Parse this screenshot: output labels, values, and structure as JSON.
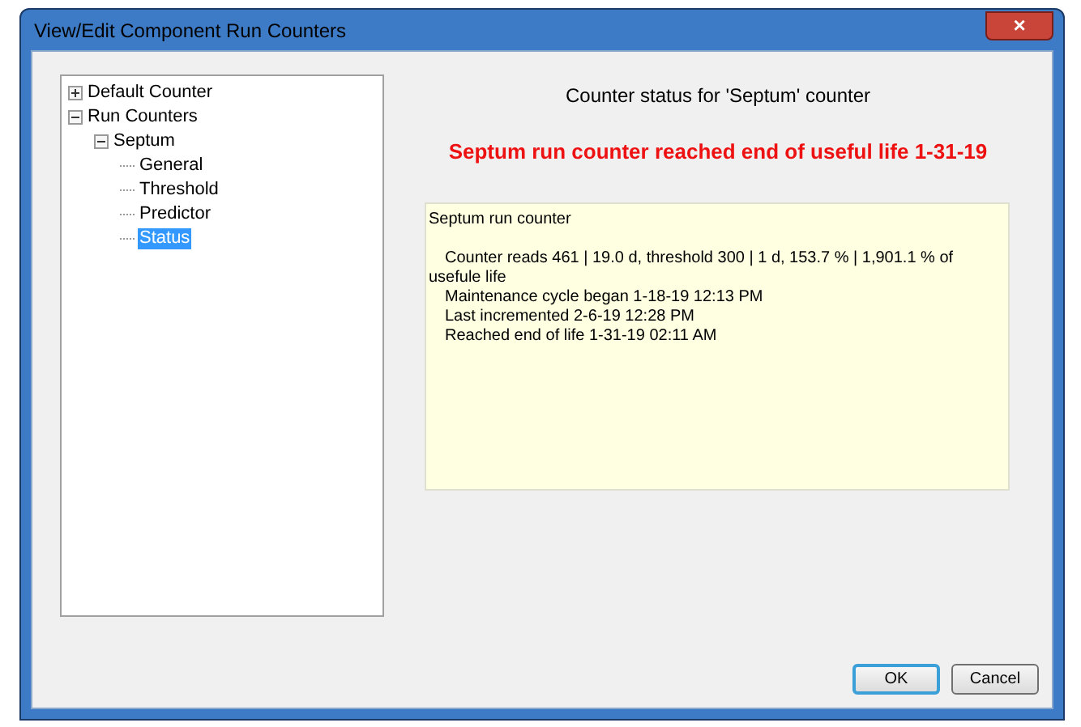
{
  "window": {
    "title": "View/Edit Component Run Counters",
    "close": "×"
  },
  "tree": [
    {
      "label": "Default Counter",
      "expanded": false,
      "selected": false
    },
    {
      "label": "Run Counters",
      "expanded": true,
      "selected": false,
      "children": [
        {
          "label": "Septum",
          "expanded": true,
          "selected": false,
          "children": [
            {
              "label": "General",
              "selected": false
            },
            {
              "label": "Threshold",
              "selected": false
            },
            {
              "label": "Predictor",
              "selected": false
            },
            {
              "label": "Status",
              "selected": true
            }
          ]
        }
      ]
    }
  ],
  "heading": "Counter status for 'Septum' counter",
  "alert": "Septum run counter reached end of useful life 1-31-19",
  "details": {
    "title": "Septum run counter",
    "lines": [
      "Counter reads 461 | 19.0 d, threshold 300 | 1 d, 153.7 % | 1,901.1 % of usefule life",
      "Maintenance cycle began 1-18-19 12:13 PM",
      "Last incremented 2-6-19 12:28 PM",
      "Reached end of life 1-31-19 02:11 AM"
    ]
  },
  "buttons": [
    {
      "label": "OK",
      "default": true
    },
    {
      "label": "Cancel",
      "default": false
    }
  ]
}
